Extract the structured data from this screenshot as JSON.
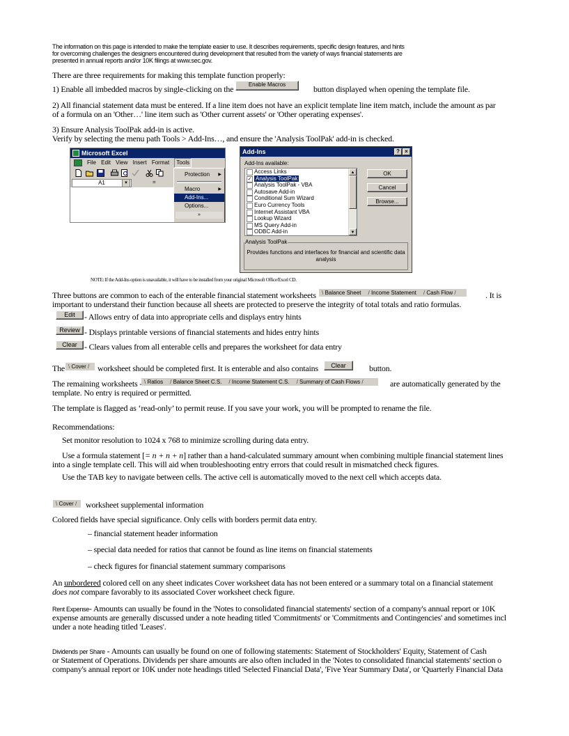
{
  "intro": {
    "line1": "The information on this page is intended to make the template easier to use.  It describes requirements, specific design features, and hints",
    "line2": "for overcoming challenges the designers encountered during development that resulted from the variety of ways financial statements are",
    "line3": "presented in annual reports and/or 10K filings at www.sec.gov."
  },
  "requirements": {
    "heading": "There are three requirements for making this template function properly:",
    "req1_pre": "1)   Enable all imbedded macros by single-clicking on the",
    "enable_macros_button": "Enable Macros",
    "req1_post": "button displayed when opening the template file.",
    "req2_line1": "2)   All financial statement data must be entered.  If a line item does not have an explicit template line item match, include the amount as par",
    "req2_line2": "of a formula on an 'Other…' line item such as 'Other current assets' or 'Other operating expenses'.",
    "req3_line1": "3)   Ensure Analysis ToolPak add-in is active.",
    "req3_line2_pre": "Verify by selecting the menu path ",
    "req3_tools": "Tools",
    "req3_gt": "  >  ",
    "req3_addins": "Add-Ins…",
    "req3_line2_post": ", and ensure the 'Analysis ToolPak' add-in is checked."
  },
  "excel": {
    "title": "Microsoft Excel",
    "menus": [
      "File",
      "Edit",
      "View",
      "Insert",
      "Format",
      "Tools"
    ],
    "name_box": "A1",
    "equals": "=",
    "tools_menu": [
      {
        "label": "Protection",
        "submenu": true,
        "selected": false
      },
      {
        "label": "Macro",
        "submenu": true,
        "selected": false
      },
      {
        "label": "Add-Ins...",
        "submenu": false,
        "selected": true
      },
      {
        "label": "Options...",
        "submenu": false,
        "selected": false
      }
    ],
    "expand_glyph": "»"
  },
  "addins_dialog": {
    "title": "Add-Ins",
    "help": "?",
    "close": "×",
    "available_label": "Add-Ins available:",
    "items": [
      {
        "label": "Access Links",
        "checked": false,
        "selected": false
      },
      {
        "label": "Analysis ToolPak",
        "checked": true,
        "selected": true
      },
      {
        "label": "Analysis ToolPak - VBA",
        "checked": false,
        "selected": false
      },
      {
        "label": "Autosave Add-in",
        "checked": false,
        "selected": false
      },
      {
        "label": "Conditional Sum Wizard",
        "checked": false,
        "selected": false
      },
      {
        "label": "Euro Currency Tools",
        "checked": false,
        "selected": false
      },
      {
        "label": "Internet Assistant VBA",
        "checked": false,
        "selected": false
      },
      {
        "label": "Lookup Wizard",
        "checked": false,
        "selected": false
      },
      {
        "label": "MS Query Add-in",
        "checked": false,
        "selected": false
      },
      {
        "label": "ODBC Add-in",
        "checked": false,
        "selected": false
      }
    ],
    "ok": "OK",
    "cancel": "Cancel",
    "browse": "Browse...",
    "group_label": "Analysis ToolPak",
    "description": "Provides functions and interfaces for financial and scientific data analysis"
  },
  "note": "NOTE:  If the Add-Ins option is unavailable, it will have to be installed from your original Microsoft Office/Excel CD.",
  "buttons_section": {
    "line1_pre": "Three buttons are common to each of the enterable financial statement worksheets",
    "tabs": [
      "Balance Sheet",
      "Income Statement",
      "Cash Flow"
    ],
    "line1_post": ".  It is",
    "line2": "important to understand their function because all sheets are protected to preserve the integrity of total totals and ratio formulas.",
    "items": [
      {
        "button": "Edit",
        "desc": "- Allows entry of data into appropriate cells and displays entry hints"
      },
      {
        "button": "Review",
        "desc": "- Displays printable versions of financial statements and hides entry hints"
      },
      {
        "button": "Clear",
        "desc": "- Clears values from all enterable cells and prepares the worksheet for data entry"
      }
    ]
  },
  "cover_section": {
    "pre": "The",
    "tab": "Cover",
    "mid": "worksheet should be completed first.  It is enterable and also contains",
    "button": "Clear",
    "post": "button."
  },
  "remaining_section": {
    "pre": "The remaining worksheets -",
    "tabs": [
      "Ratios",
      "Balance Sheet C.S.",
      "Income Statement C.S.",
      "Summary of Cash Flows"
    ],
    "post": "are automatically generated by the",
    "line2": "template.  No entry is required or permitted."
  },
  "readonly_text": "The template is flagged as ‘read-only’ to permit reuse.  If you save your work, you will be prompted to rename the file.",
  "recommendations": {
    "heading": "Recommendations:",
    "rec1": "Set monitor resolution to 1024 x 768 to minimize scrolling during data entry.",
    "rec2_pre": "Use a formula statement [",
    "rec2_formula": "= n + n + n",
    "rec2_post": "] rather than a hand-calculated summary amount when combining multiple financial statement lines",
    "rec2_line2": "into a single template cell.  This will aid when troubleshooting entry errors that could result in mismatched check figures.",
    "rec3": "Use the TAB key to navigate between cells.  The active cell is automatically moved to the next cell which accepts data."
  },
  "supplemental": {
    "tab": "Cover",
    "heading": "worksheet supplemental information",
    "colored_fields": "Colored fields have special significance.  Only cells with borders permit data entry.",
    "legend": [
      "– financial statement header information",
      "– special data needed for ratios that cannot be found as line items on financial statements",
      "– check figures for financial statement summary comparisons"
    ],
    "unbordered_pre": "An ",
    "unbordered_word": "unbordered",
    "unbordered_post": " colored cell on any sheet indicates Cover worksheet data has not been entered or a summary total on a financial statement",
    "does_not": "does not",
    "unbordered_line2_post": " compare favorably to its associated Cover worksheet check figure."
  },
  "rent_expense": {
    "label": "Rent Expense",
    "line1": "- Amounts can usually be found in the 'Notes to consolidated financial statements' section of a company's annual report or 10K",
    "line2": "expense amounts are generally discussed under a note heading titled 'Commitments' or 'Commitments and Contingencies' and sometimes incl",
    "line3": "under a note heading titled 'Leases'."
  },
  "dividends": {
    "label": "Dividends per Share",
    "line1": " - Amounts can usually be found on one of following statements:  Statement of Stockholders' Equity, Statement of Cash",
    "line2": "or Statement of Operations.  Dividends per share amounts are also often included in the 'Notes to consolidated financial statements' section o",
    "line3": "company's annual report or 10K under note headings titled 'Selected Financial Data', 'Five Year Summary Data', or 'Quarterly Financial Data"
  }
}
